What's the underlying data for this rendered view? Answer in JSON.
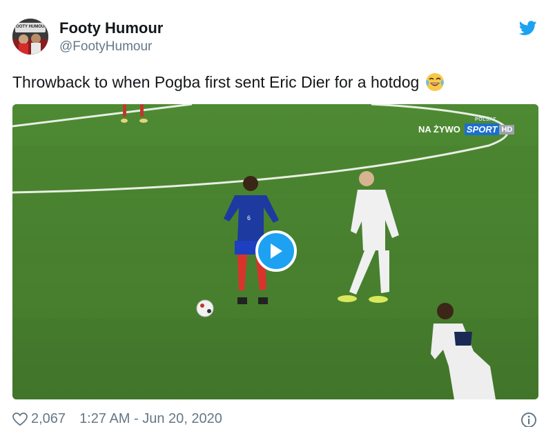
{
  "author": {
    "display_name": "Footy Humour",
    "handle": "@FootyHumour",
    "avatar_text": "FOOTY HUMOUR"
  },
  "tweet": {
    "text": "Throwback to when Pogba first sent Eric Dier for a hotdog",
    "emoji": "face-with-tears-of-joy"
  },
  "video": {
    "overlay_live": "NA ŻYWO",
    "overlay_channel": "SPORT",
    "overlay_hd": "HD",
    "overlay_brand": "POLSAT",
    "jersey_number": "6",
    "pitch_color": "#4c7f2f"
  },
  "footer": {
    "likes": "2,067",
    "timestamp": "1:27 AM - Jun 20, 2020"
  },
  "colors": {
    "twitter_blue": "#1da1f2",
    "muted_text": "#657786",
    "primary_text": "#14171a"
  },
  "icons": {
    "bird": "twitter-bird-icon",
    "play": "play-icon",
    "heart": "heart-icon",
    "info": "info-icon"
  }
}
